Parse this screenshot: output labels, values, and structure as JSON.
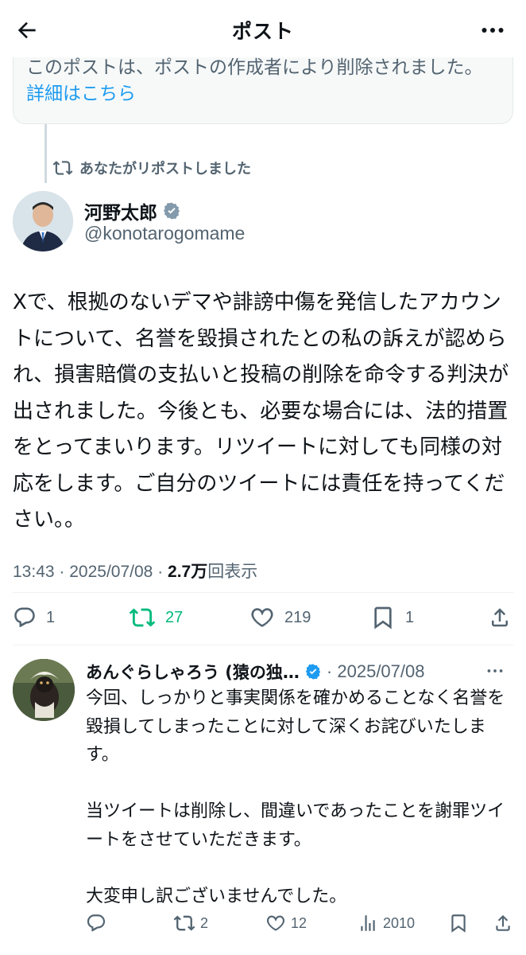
{
  "header": {
    "title": "ポスト"
  },
  "deleted_quote": {
    "text": "このポストは、ポストの作成者により削除されました。",
    "link": "詳細はこちら"
  },
  "repost_label": "あなたがリポストしました",
  "post": {
    "author_name": "河野太郎",
    "author_handle": "@konotarogomame",
    "body": "Xで、根拠のないデマや誹謗中傷を発信したアカウントについて、名誉を毀損されたとの私の訴えが認められ、損害賠償の支払いと投稿の削除を命令する判決が出されました。今後とも、必要な場合には、法的措置をとってまいります。リツイートに対しても同様の対応をします。ご自分のツイートには責任を持ってください。。",
    "time": "13:43",
    "date": "2025/07/08",
    "views_count": "2.7万",
    "views_label": "回表示",
    "replies": "1",
    "reposts": "27",
    "likes": "219",
    "bookmarks": "1"
  },
  "reply": {
    "author_name": "あんぐらしゃろう (猿の独…",
    "date": "2025/07/08",
    "body": "今回、しっかりと事実関係を確かめることなく名誉を毀損してしまったことに対して深くお詫びいたします。\n\n当ツイートは削除し、間違いであったことを謝罪ツイートをさせていただきます。\n\n大変申し訳ございませんでした。",
    "replies": "",
    "reposts": "2",
    "likes": "12",
    "views": "2010"
  },
  "colors": {
    "accent": "#1d9bf0",
    "repost_active": "#00ba7c",
    "secondary_text": "#536471",
    "primary_text": "#0f1419"
  },
  "icons": {
    "back": "arrow-left-icon",
    "more": "more-horizontal-icon",
    "repost": "repost-icon",
    "verified": "verified-badge-icon",
    "reply": "reply-icon",
    "like": "heart-icon",
    "bookmark": "bookmark-icon",
    "share": "share-icon",
    "views": "views-icon"
  }
}
